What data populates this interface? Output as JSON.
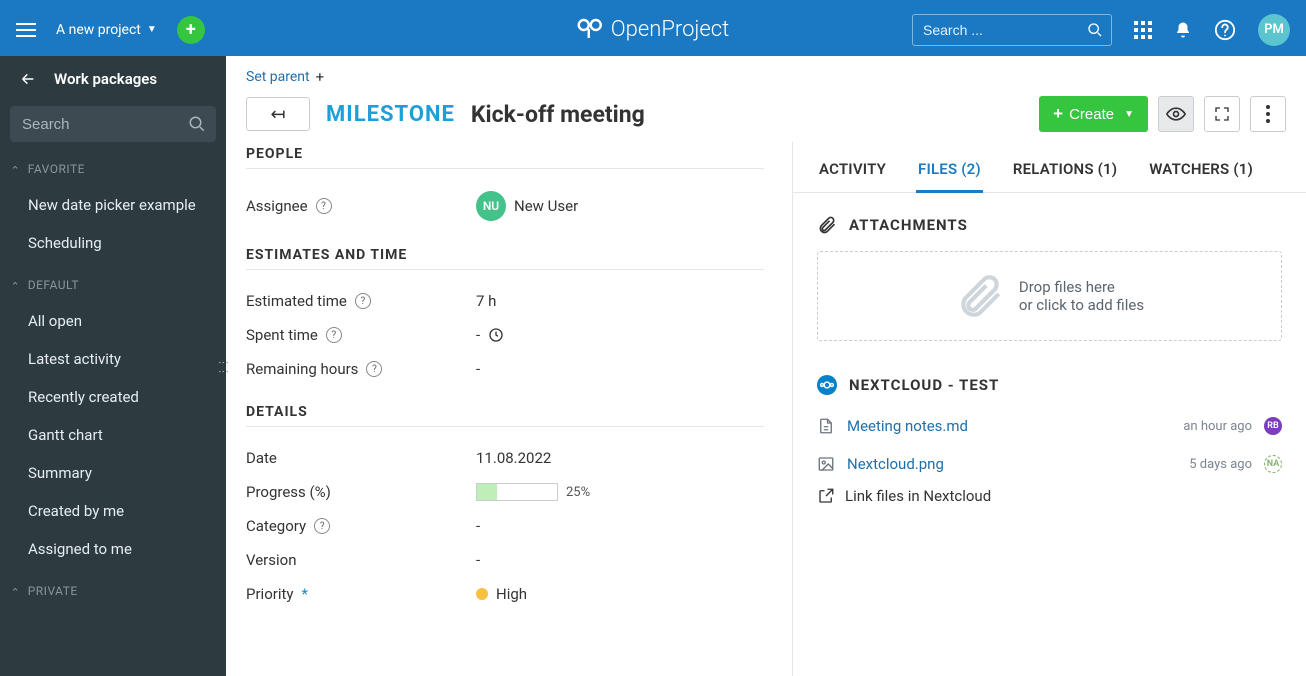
{
  "header": {
    "project_name": "A new project",
    "search_placeholder": "Search ...",
    "logo_text": "OpenProject",
    "avatar_initials": "PM"
  },
  "sidebar": {
    "title": "Work packages",
    "search_placeholder": "Search",
    "groups": {
      "favorite": {
        "label": "FAVORITE",
        "items": [
          "New date picker example",
          "Scheduling"
        ]
      },
      "default": {
        "label": "DEFAULT",
        "items": [
          "All open",
          "Latest activity",
          "Recently created",
          "Gantt chart",
          "Summary",
          "Created by me",
          "Assigned to me"
        ]
      },
      "private": {
        "label": "PRIVATE"
      }
    }
  },
  "wp": {
    "set_parent": "Set parent",
    "type": "MILESTONE",
    "title": "Kick-off meeting",
    "create_label": "Create",
    "sections": {
      "people": "PEOPLE",
      "estimates": "ESTIMATES AND TIME",
      "details": "DETAILS"
    },
    "fields": {
      "assignee_label": "Assignee",
      "assignee_initials": "NU",
      "assignee_value": "New User",
      "estimated_label": "Estimated time",
      "estimated_value": "7 h",
      "spent_label": "Spent time",
      "spent_value": "-",
      "remaining_label": "Remaining hours",
      "remaining_value": "-",
      "date_label": "Date",
      "date_value": "11.08.2022",
      "progress_label": "Progress (%)",
      "progress_value": "25%",
      "progress_num": 25,
      "category_label": "Category",
      "category_value": "-",
      "version_label": "Version",
      "version_value": "-",
      "priority_label": "Priority",
      "priority_value": "High"
    }
  },
  "tabs": {
    "activity": "ACTIVITY",
    "files": "FILES (2)",
    "relations": "RELATIONS (1)",
    "watchers": "WATCHERS (1)"
  },
  "attachments": {
    "label": "ATTACHMENTS",
    "drop1": "Drop files here",
    "drop2": "or click to add files"
  },
  "nextcloud": {
    "label": "NEXTCLOUD - TEST",
    "files": [
      {
        "name": "Meeting notes.md",
        "time": "an hour ago",
        "avatar": "RB",
        "avatarClass": "rb",
        "icon": "doc"
      },
      {
        "name": "Nextcloud.png",
        "time": "5 days ago",
        "avatar": "NA",
        "avatarClass": "na",
        "icon": "img"
      }
    ],
    "link_action": "Link files in Nextcloud"
  }
}
